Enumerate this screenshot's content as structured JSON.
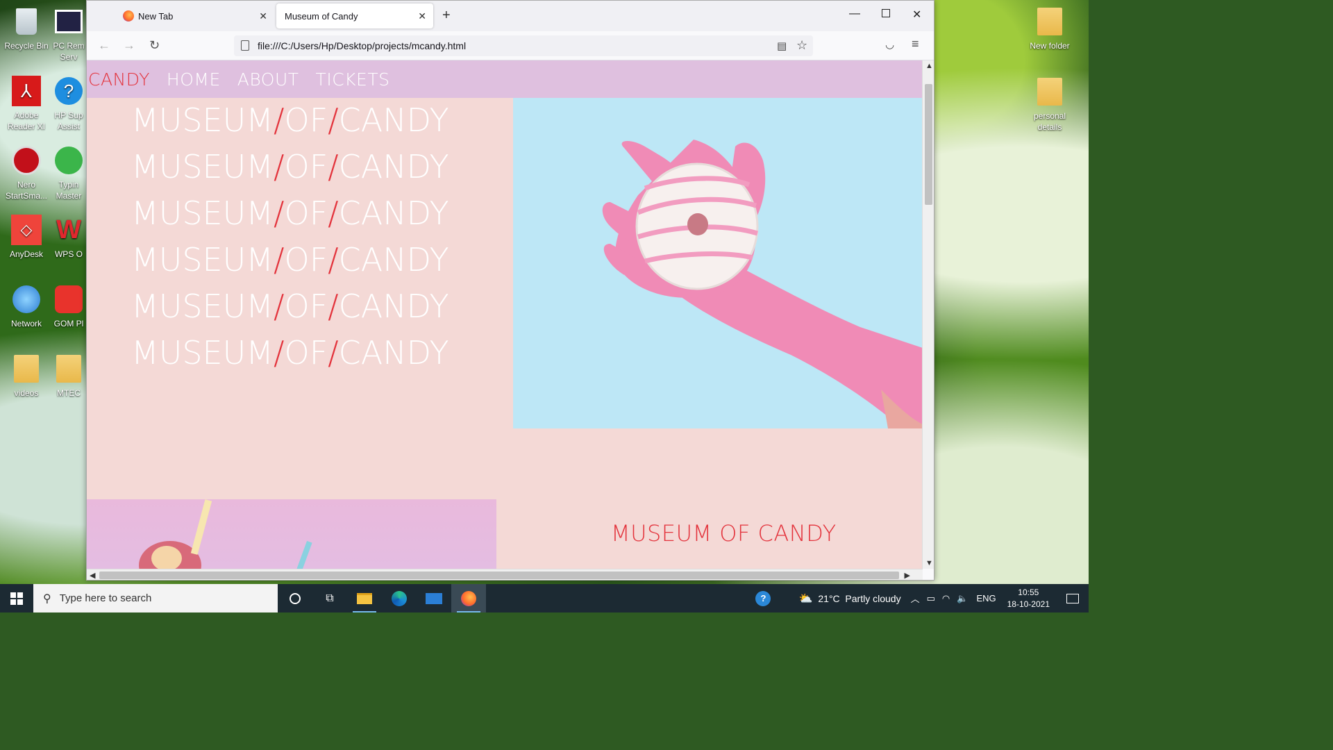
{
  "desktop": {
    "left_icons": [
      {
        "label": "Recycle Bin",
        "icon": "recycle-bin-icon"
      },
      {
        "label": "Adobe Reader XI",
        "icon": "adobe-reader-icon"
      },
      {
        "label": "Nero StartSma...",
        "icon": "nero-icon"
      },
      {
        "label": "AnyDesk",
        "icon": "anydesk-icon"
      },
      {
        "label": "Network",
        "icon": "network-icon"
      },
      {
        "label": "videos",
        "icon": "folder-icon"
      }
    ],
    "second_col_icons": [
      {
        "label": "PC Rem Serv",
        "icon": "pc-remote-icon"
      },
      {
        "label": "HP Sup Assist",
        "icon": "hp-support-icon"
      },
      {
        "label": "Typin Master",
        "icon": "typing-master-icon"
      },
      {
        "label": "WPS O",
        "icon": "wps-office-icon"
      },
      {
        "label": "GOM Pl",
        "icon": "gom-player-icon"
      },
      {
        "label": "MTEC",
        "icon": "folder-icon"
      }
    ],
    "right_icons": [
      {
        "label": "New folder",
        "icon": "folder-icon"
      },
      {
        "label": "personal details",
        "icon": "folder-icon"
      }
    ]
  },
  "browser": {
    "tabs": [
      {
        "title": "New Tab",
        "active": false
      },
      {
        "title": "Museum of Candy",
        "active": true
      }
    ],
    "url": "file:///C:/Users/Hp/Desktop/projects/mcandy.html"
  },
  "site": {
    "brand": "CANDY",
    "nav": [
      "HOME",
      "ABOUT",
      "TICKETS"
    ],
    "hero_lines": [
      [
        "MUSEUM",
        "/",
        "OF",
        "/",
        "CANDY"
      ],
      [
        "MUSEUM",
        "/",
        "OF",
        "/",
        "CANDY"
      ],
      [
        "MUSEUM",
        "/",
        "OF",
        "/",
        "CANDY"
      ],
      [
        "MUSEUM",
        "/",
        "OF",
        "/",
        "CANDY"
      ],
      [
        "MUSEUM",
        "/",
        "OF",
        "/",
        "CANDY"
      ],
      [
        "MUSEUM",
        "/",
        "OF",
        "/",
        "CANDY"
      ]
    ],
    "section_title": "MUSEUM OF CANDY",
    "colors": {
      "page_bg": "#f4d9d6",
      "nav_bg": "#dfc0df",
      "accent_red": "#e3333c",
      "hero_img_bg": "#bde7f6",
      "glove_pink": "#f08bb6"
    }
  },
  "taskbar": {
    "search_placeholder": "Type here to search",
    "weather": "21°C  Partly cloudy",
    "language": "ENG",
    "time": "10:55",
    "date": "18-10-2021"
  }
}
